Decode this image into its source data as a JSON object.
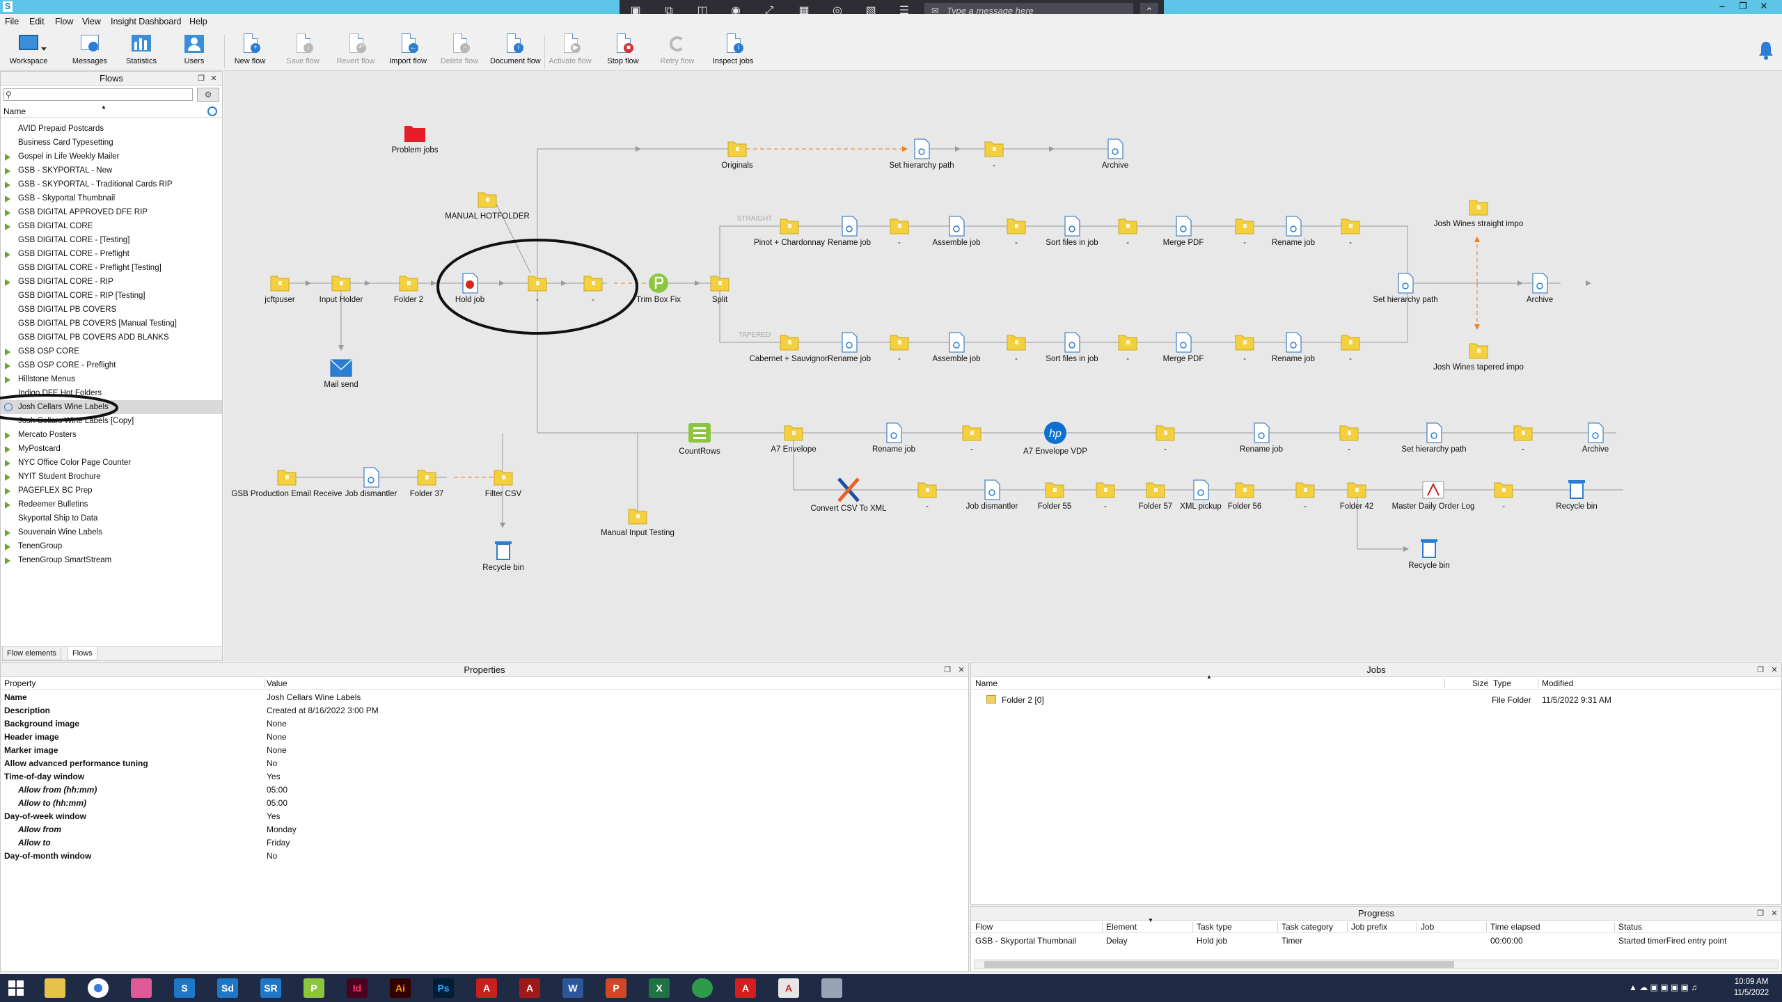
{
  "app": {
    "logo_letter": "S"
  },
  "remote_toolbar": {
    "message_placeholder": "Type a message here"
  },
  "menu": [
    "File",
    "Edit",
    "Flow",
    "View",
    "Insight Dashboard",
    "Help"
  ],
  "toolbar": [
    {
      "label": "Workspace",
      "enabled": true
    },
    {
      "label": "Messages",
      "enabled": true
    },
    {
      "label": "Statistics",
      "enabled": true
    },
    {
      "label": "Users",
      "enabled": true
    },
    {
      "label": "New flow",
      "enabled": true
    },
    {
      "label": "Save flow",
      "enabled": false
    },
    {
      "label": "Revert flow",
      "enabled": false
    },
    {
      "label": "Import flow",
      "enabled": true
    },
    {
      "label": "Delete flow",
      "enabled": false
    },
    {
      "label": "Document flow",
      "enabled": true
    },
    {
      "label": "Activate flow",
      "enabled": false
    },
    {
      "label": "Stop flow",
      "enabled": true
    },
    {
      "label": "Retry flow",
      "enabled": false
    },
    {
      "label": "Inspect jobs",
      "enabled": true
    }
  ],
  "flows_panel": {
    "title": "Flows",
    "search_placeholder": "",
    "column_name": "Name",
    "items": [
      {
        "label": "AVID Prepaid Postcards",
        "group": false
      },
      {
        "label": "Business Card Typesetting",
        "group": false
      },
      {
        "label": "Gospel in Life Weekly Mailer",
        "group": true
      },
      {
        "label": "GSB - SKYPORTAL - New",
        "group": true
      },
      {
        "label": "GSB - SKYPORTAL - Traditional Cards RIP",
        "group": true
      },
      {
        "label": "GSB - Skyportal Thumbnail",
        "group": true
      },
      {
        "label": "GSB DIGITAL APPROVED DFE RIP",
        "group": true
      },
      {
        "label": "GSB DIGITAL CORE",
        "group": true
      },
      {
        "label": "GSB DIGITAL CORE - [Testing]",
        "group": false
      },
      {
        "label": "GSB DIGITAL CORE - Preflight",
        "group": true
      },
      {
        "label": "GSB DIGITAL CORE - Preflight [Testing]",
        "group": false
      },
      {
        "label": "GSB DIGITAL CORE - RIP",
        "group": true
      },
      {
        "label": "GSB DIGITAL CORE - RIP [Testing]",
        "group": false
      },
      {
        "label": "GSB DIGITAL PB COVERS",
        "group": false
      },
      {
        "label": "GSB DIGITAL PB COVERS [Manual Testing]",
        "group": false
      },
      {
        "label": "GSB DIGITAL PB COVERS ADD BLANKS",
        "group": false
      },
      {
        "label": "GSB OSP CORE",
        "group": true
      },
      {
        "label": "GSB OSP CORE - Preflight",
        "group": true
      },
      {
        "label": "Hillstone Menus",
        "group": true
      },
      {
        "label": "Indigo DFE Hot Folders",
        "group": false
      },
      {
        "label": "Josh Cellars Wine Labels",
        "group": false,
        "selected": true
      },
      {
        "label": "Josh Cellars Wine Labels [Copy]",
        "group": false
      },
      {
        "label": "Mercato Posters",
        "group": true
      },
      {
        "label": "MyPostcard",
        "group": true
      },
      {
        "label": "NYC Office Color Page Counter",
        "group": true
      },
      {
        "label": "NYIT Student Brochure",
        "group": true
      },
      {
        "label": "PAGEFLEX BC Prep",
        "group": true
      },
      {
        "label": "Redeemer Bulletins",
        "group": true
      },
      {
        "label": "Skyportal Ship to Data",
        "group": false
      },
      {
        "label": "Souvenain Wine Labels",
        "group": true
      },
      {
        "label": "TenenGroup",
        "group": true
      },
      {
        "label": "TenenGroup SmartStream",
        "group": true
      }
    ],
    "tabs": [
      "Flow elements",
      "Flows"
    ]
  },
  "canvas": {
    "nodes": [
      {
        "label": "Problem jobs"
      },
      {
        "label": "MANUAL HOTFOLDER"
      },
      {
        "label": "jcftpuser"
      },
      {
        "label": "Input Holder"
      },
      {
        "label": "Folder 2"
      },
      {
        "label": "Hold job"
      },
      {
        "label": "-"
      },
      {
        "label": "-"
      },
      {
        "label": "Trim Box Fix"
      },
      {
        "label": "Split"
      },
      {
        "label": "Mail send"
      },
      {
        "label": "Originals"
      },
      {
        "label": "Set hierarchy path"
      },
      {
        "label": "-"
      },
      {
        "label": "Archive"
      },
      {
        "label": "STRAIGHT"
      },
      {
        "label": "Pinot + Chardonnay"
      },
      {
        "label": "Rename job"
      },
      {
        "label": "-"
      },
      {
        "label": "Assemble job"
      },
      {
        "label": "-"
      },
      {
        "label": "Sort files in job"
      },
      {
        "label": "-"
      },
      {
        "label": "Merge PDF"
      },
      {
        "label": "-"
      },
      {
        "label": "Rename job"
      },
      {
        "label": "-"
      },
      {
        "label": "Josh Wines straight impo"
      },
      {
        "label": "Set hierarchy path"
      },
      {
        "label": "Archive"
      },
      {
        "label": "Josh Wines tapered impo"
      },
      {
        "label": "TAPERED"
      },
      {
        "label": "Cabernet + Sauvignon"
      },
      {
        "label": "Rename job"
      },
      {
        "label": "-"
      },
      {
        "label": "Assemble job"
      },
      {
        "label": "-"
      },
      {
        "label": "Sort files in job"
      },
      {
        "label": "-"
      },
      {
        "label": "Merge PDF"
      },
      {
        "label": "-"
      },
      {
        "label": "Rename job"
      },
      {
        "label": "-"
      },
      {
        "label": "CountRows"
      },
      {
        "label": "A7 Envelope"
      },
      {
        "label": "Rename job"
      },
      {
        "label": "-"
      },
      {
        "label": "A7 Envelope VDP"
      },
      {
        "label": "-"
      },
      {
        "label": "Rename job"
      },
      {
        "label": "-"
      },
      {
        "label": "Set hierarchy path"
      },
      {
        "label": "-"
      },
      {
        "label": "Archive"
      },
      {
        "label": "GSB Production Email Receive"
      },
      {
        "label": "Job dismantler"
      },
      {
        "label": "Folder 37"
      },
      {
        "label": "Filter CSV"
      },
      {
        "label": "Recycle bin"
      },
      {
        "label": "Manual Input Testing"
      },
      {
        "label": "Convert CSV To XML"
      },
      {
        "label": "-"
      },
      {
        "label": "Job dismantler"
      },
      {
        "label": "Folder 55"
      },
      {
        "label": "-"
      },
      {
        "label": "Folder 57"
      },
      {
        "label": "XML pickup"
      },
      {
        "label": "Folder 56"
      },
      {
        "label": "-"
      },
      {
        "label": "Folder 42"
      },
      {
        "label": "Master Daily Order Log"
      },
      {
        "label": "-"
      },
      {
        "label": "Recycle bin"
      },
      {
        "label": "Recycle bin"
      }
    ]
  },
  "properties": {
    "title": "Properties",
    "col_property": "Property",
    "col_value": "Value",
    "rows": [
      {
        "key": "Name",
        "value": "Josh Cellars Wine Labels",
        "sub": false
      },
      {
        "key": "Description",
        "value": "Created at 8/16/2022 3:00 PM",
        "sub": false
      },
      {
        "key": "Background image",
        "value": "None",
        "sub": false
      },
      {
        "key": "Header image",
        "value": "None",
        "sub": false
      },
      {
        "key": "Marker image",
        "value": "None",
        "sub": false
      },
      {
        "key": "Allow advanced performance tuning",
        "value": "No",
        "sub": false
      },
      {
        "key": "Time-of-day window",
        "value": "Yes",
        "sub": false
      },
      {
        "key": "Allow from (hh:mm)",
        "value": "05:00",
        "sub": true
      },
      {
        "key": "Allow to (hh:mm)",
        "value": "05:00",
        "sub": true
      },
      {
        "key": "Day-of-week window",
        "value": "Yes",
        "sub": false
      },
      {
        "key": "Allow from",
        "value": "Monday",
        "sub": true
      },
      {
        "key": "Allow to",
        "value": "Friday",
        "sub": true
      },
      {
        "key": "Day-of-month window",
        "value": "No",
        "sub": false
      }
    ]
  },
  "jobs": {
    "title": "Jobs",
    "cols": [
      "Name",
      "Size",
      "Type",
      "Modified"
    ],
    "rows": [
      {
        "name": "Folder 2 [0]",
        "size": "",
        "type": "File Folder",
        "modified": "11/5/2022 9:31 AM"
      }
    ]
  },
  "progress": {
    "title": "Progress",
    "cols": [
      "Flow",
      "Element",
      "Task type",
      "Task category",
      "Job prefix",
      "Job",
      "Time elapsed",
      "Status"
    ],
    "rows": [
      {
        "flow": "GSB - Skyportal Thumbnail",
        "element": "Delay",
        "task_type": "Hold job",
        "task_category": "Timer",
        "job_prefix": "",
        "job": "",
        "time_elapsed": "00:00:00",
        "status": "Started timerFired entry point"
      }
    ]
  },
  "taskbar": {
    "time": "10:09 AM",
    "date": "11/5/2022"
  }
}
